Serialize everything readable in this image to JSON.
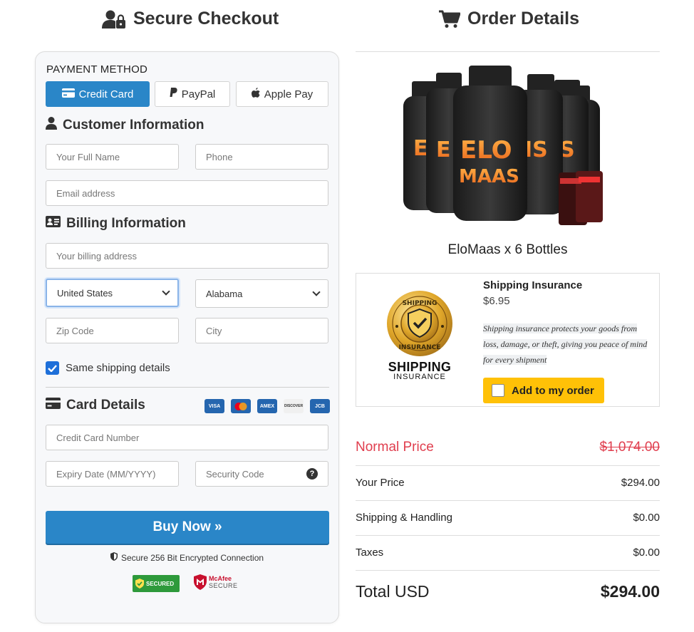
{
  "checkout": {
    "title": "Secure Checkout",
    "payment_method_label": "PAYMENT METHOD",
    "methods": [
      {
        "label": "Credit Card",
        "icon": "credit-card-icon",
        "active": true
      },
      {
        "label": "PayPal",
        "icon": "paypal-icon",
        "active": false
      },
      {
        "label": "Apple Pay",
        "icon": "apple-icon",
        "active": false
      }
    ],
    "customer_heading": "Customer Information",
    "full_name_placeholder": "Your Full Name",
    "phone_placeholder": "Phone",
    "email_placeholder": "Email address",
    "billing_heading": "Billing Information",
    "billing_address_placeholder": "Your billing address",
    "country_value": "United States",
    "state_value": "Alabama",
    "zip_placeholder": "Zip Code",
    "city_placeholder": "City",
    "same_shipping_label": "Same shipping details",
    "same_shipping_checked": true,
    "card_heading": "Card Details",
    "card_brands": [
      "VISA",
      "MC",
      "AMEX",
      "DISCOVER",
      "JCB"
    ],
    "card_number_placeholder": "Credit Card Number",
    "expiry_placeholder": "Expiry Date (MM/YYYY)",
    "cvv_placeholder": "Security Code",
    "cvv_help": "?",
    "buy_label": "Buy Now »",
    "secure_text": "Secure 256 Bit Encrypted Connection",
    "trust_badge": "SECURED",
    "mcafee_top": "McAfee",
    "mcafee_bottom": "SECURE"
  },
  "order": {
    "title": "Order Details",
    "product_name": "EloMaas x 6 Bottles",
    "product_brand_text": "ELO MAAS",
    "insurance": {
      "title": "Shipping Insurance",
      "price": "$6.95",
      "description": "Shipping insurance protects your goods from loss, damage, or theft, giving you peace of mind for every shipment",
      "button_label": "Add to my order",
      "seal_top": "SHIPPING",
      "seal_bottom": "INSURANCE",
      "logo_main": "SHIPPING",
      "logo_sub": "INSURANCE"
    },
    "rows": [
      {
        "label": "Normal Price",
        "value": "$1,074.00"
      },
      {
        "label": "Your Price",
        "value": "$294.00"
      },
      {
        "label": "Shipping & Handling",
        "value": "$0.00"
      },
      {
        "label": "Taxes",
        "value": "$0.00"
      },
      {
        "label": "Total USD",
        "value": "$294.00"
      }
    ]
  },
  "colors": {
    "primary": "#2a86c8",
    "insurance_button": "#ffc107",
    "normal_price": "#e03e4e",
    "checkbox": "#1e6fd9"
  }
}
